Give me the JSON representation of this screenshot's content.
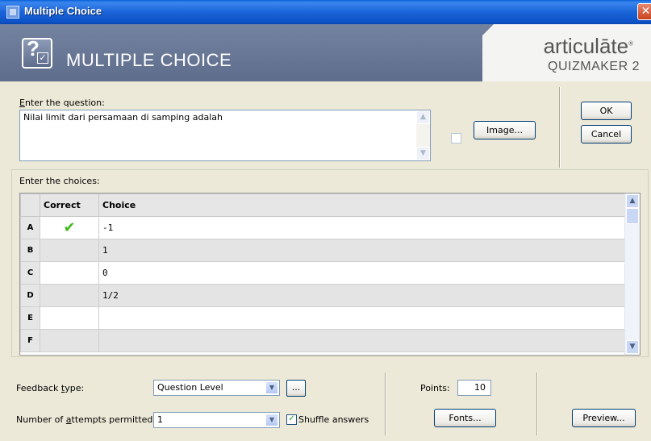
{
  "window": {
    "title": "Multiple Choice",
    "close_glyph": "✕"
  },
  "banner": {
    "title": "MULTIPLE CHOICE",
    "brand_line1": "articulāte",
    "brand_mark": "®",
    "brand_line2": "QUIZMAKER 2",
    "icon": "question-checkbox-icon"
  },
  "question": {
    "label_prefix": "E",
    "label_rest": "nter the question:",
    "text": "Nilai limit dari persamaan di samping adalah",
    "image_button": "Image..."
  },
  "dialog": {
    "ok": "OK",
    "cancel": "Cancel"
  },
  "choices": {
    "label": "Enter the choices:",
    "columns": [
      "Correct",
      "Choice"
    ],
    "rows": [
      {
        "letter": "A",
        "correct": true,
        "choice": "-1"
      },
      {
        "letter": "B",
        "correct": false,
        "choice": "1"
      },
      {
        "letter": "C",
        "correct": false,
        "choice": "0"
      },
      {
        "letter": "D",
        "correct": false,
        "choice": "1/2"
      },
      {
        "letter": "E",
        "correct": false,
        "choice": ""
      },
      {
        "letter": "F",
        "correct": false,
        "choice": ""
      }
    ],
    "correct_mark": "✔"
  },
  "feedback": {
    "label_a": "Feedback ",
    "label_u": "t",
    "label_b": "ype:",
    "value": "Question Level",
    "more_button": "..."
  },
  "attempts": {
    "label_a": "Number of ",
    "label_u": "a",
    "label_b": "ttempts permitted:",
    "value": "1"
  },
  "shuffle": {
    "label": "Shuffle answers",
    "checked": true
  },
  "points": {
    "label": "Points:",
    "value": "10"
  },
  "buttons": {
    "fonts": "Fonts...",
    "preview": "Preview..."
  },
  "colors": {
    "titlebar": "#0A5FD8",
    "banner": "#6B7A98",
    "check": "#3DBA1E",
    "dialog_bg": "#ECE9D8"
  }
}
